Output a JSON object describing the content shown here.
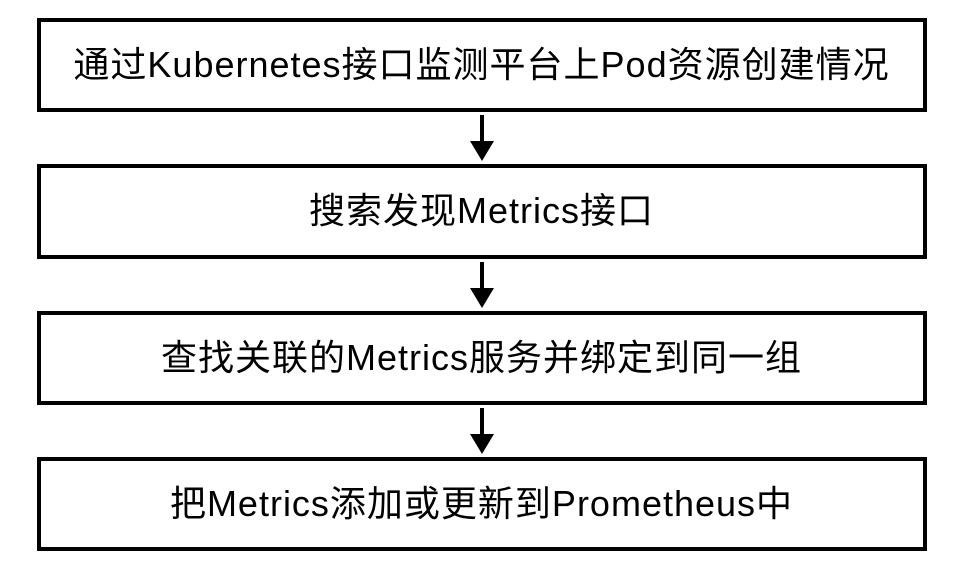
{
  "flowchart": {
    "type": "vertical-flow",
    "steps": [
      {
        "id": "step1",
        "text": "通过Kubernetes接口监测平台上Pod资源创建情况"
      },
      {
        "id": "step2",
        "text": "搜索发现Metrics接口"
      },
      {
        "id": "step3",
        "text": "查找关联的Metrics服务并绑定到同一组"
      },
      {
        "id": "step4",
        "text": "把Metrics添加或更新到Prometheus中"
      }
    ]
  }
}
